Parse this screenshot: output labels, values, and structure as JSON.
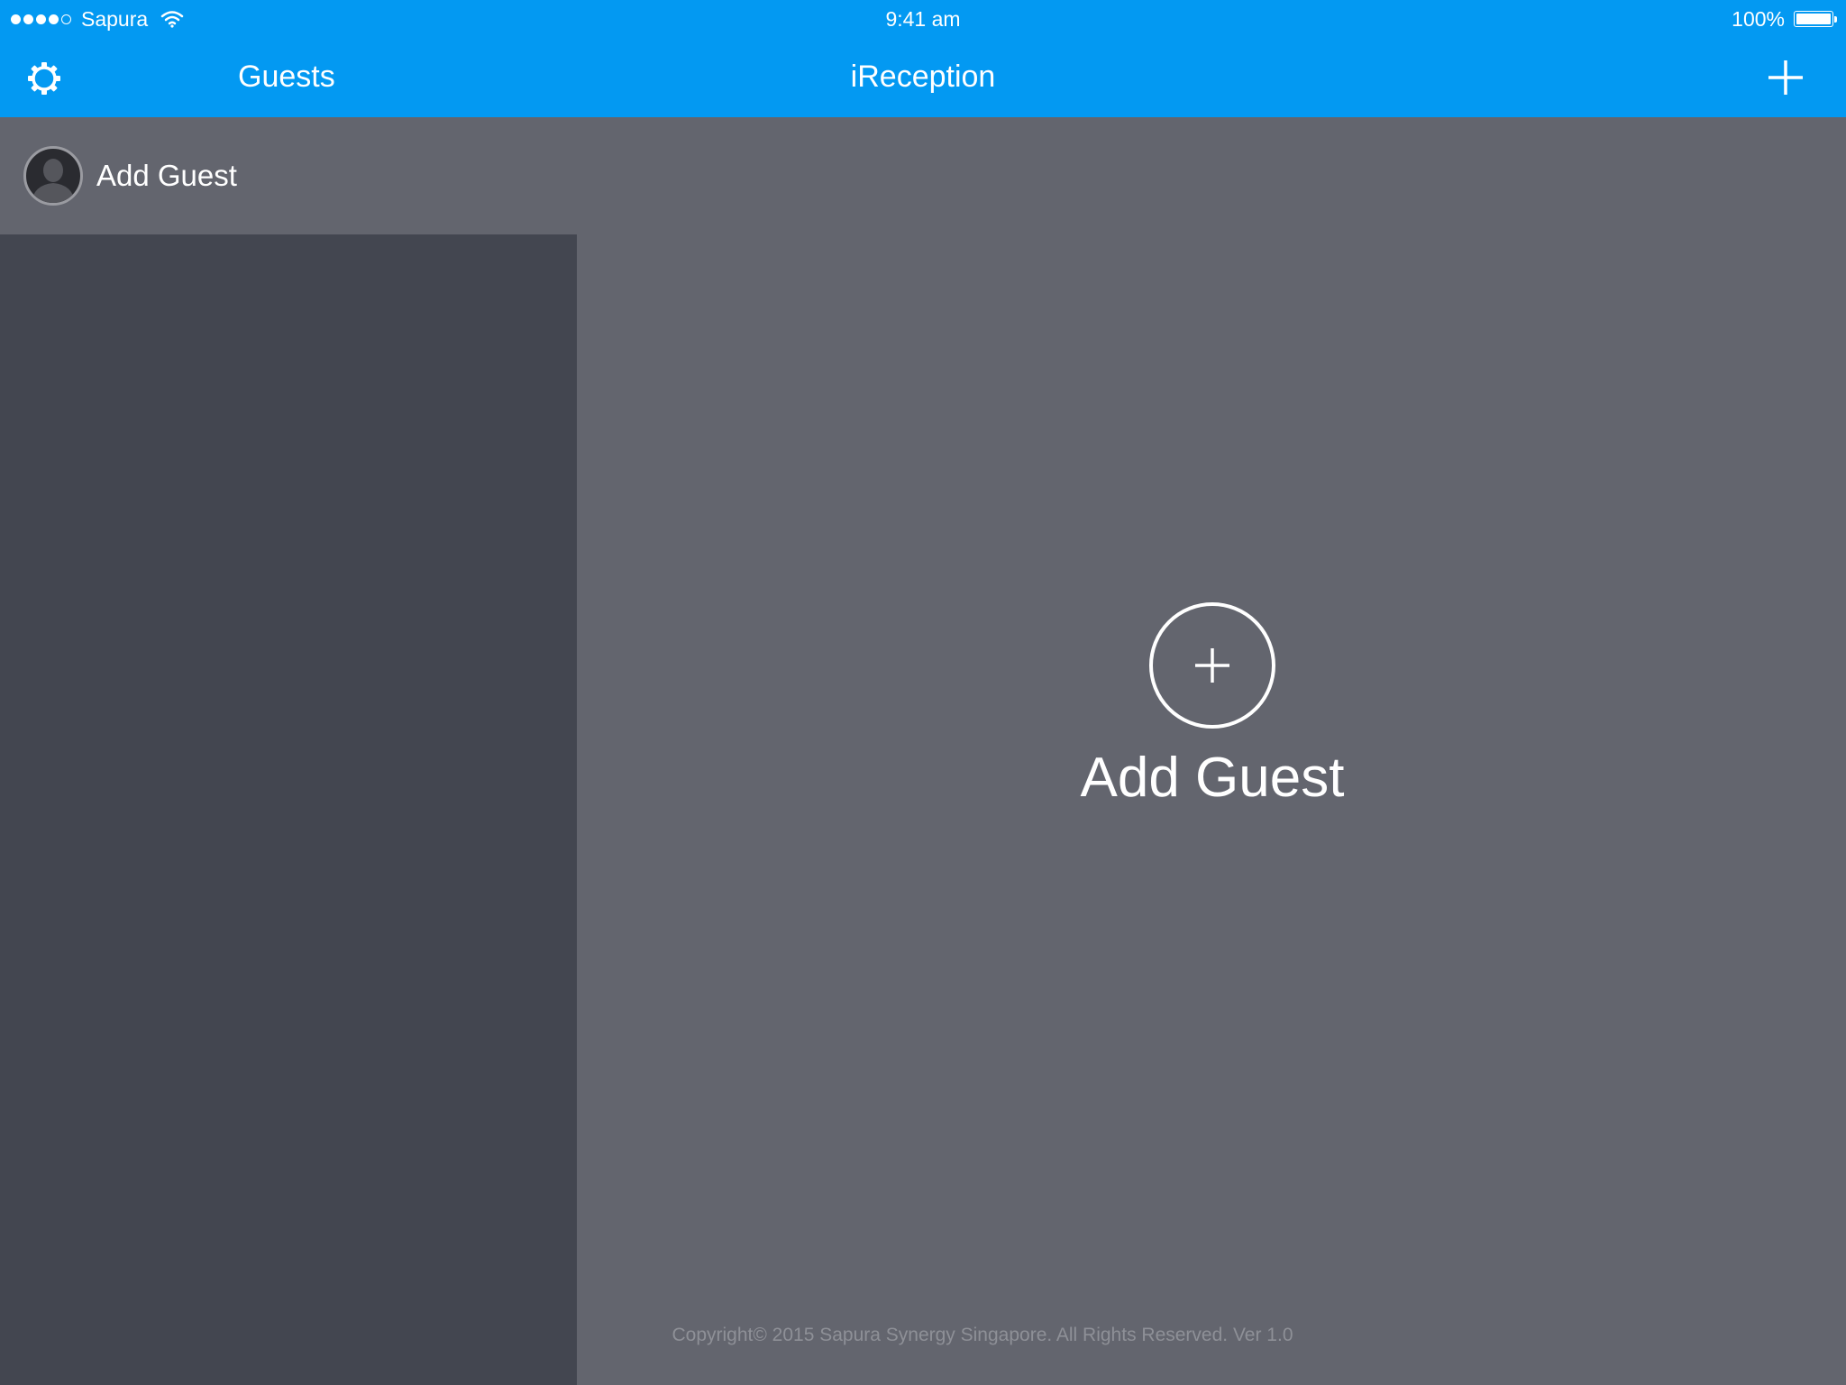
{
  "status_bar": {
    "carrier": "Sapura",
    "time": "9:41 am",
    "battery": "100%",
    "signal_bars_filled": 4,
    "signal_bars_total": 5,
    "battery_level": 1.0
  },
  "nav_bar": {
    "settings_icon": "gear-icon",
    "left_title": "Guests",
    "title": "iReception",
    "add_icon": "plus-icon"
  },
  "sidebar": {
    "items": [
      {
        "label": "Add Guest",
        "icon": "person-avatar-icon"
      }
    ]
  },
  "main": {
    "add_button_icon": "plus-circle-icon",
    "add_label": "Add Guest",
    "copyright": "Copyright© 2015 Sapura Synergy Singapore. All Rights Reserved. Ver 1.0"
  },
  "colors": {
    "bar": "#0399f2",
    "sidebar": "#434650",
    "main": "#63656e",
    "text": "#ffffff",
    "muted_text": "#8e9097"
  }
}
